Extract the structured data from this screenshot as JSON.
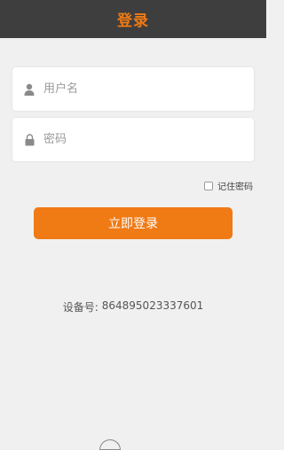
{
  "header": {
    "title": "登录"
  },
  "form": {
    "username_placeholder": "用户名",
    "password_placeholder": "密码",
    "remember_label": "记住密码",
    "login_label": "立即登录"
  },
  "device": {
    "label": "设备号:",
    "value": "864895023337601"
  },
  "icons": {
    "username": "user-icon",
    "password": "lock-icon"
  },
  "colors": {
    "accent": "#f07a14",
    "header_bg": "#3e3e3e",
    "page_bg": "#f0f0f0"
  }
}
